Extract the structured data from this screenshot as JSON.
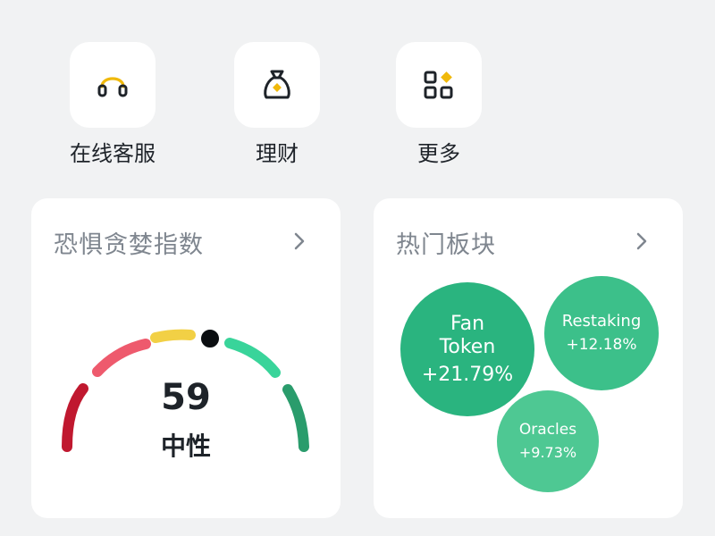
{
  "quick_actions": [
    {
      "label": "在线客服",
      "icon": "headset-icon"
    },
    {
      "label": "理财",
      "icon": "money-bag-icon"
    },
    {
      "label": "更多",
      "icon": "grid-more-icon"
    }
  ],
  "fear_greed": {
    "title": "恐惧贪婪指数",
    "score": "59",
    "sentiment": "中性",
    "level": 59,
    "colors": [
      "#c0182f",
      "#ee5a6d",
      "#f2d045",
      "#39d49a",
      "#2a9c6c"
    ]
  },
  "hot_sectors": {
    "title": "热门板块",
    "items": [
      {
        "name_line1": "Fan",
        "name_line2": "Token",
        "change": "+21.79%",
        "color": "#2ab47f"
      },
      {
        "name_line1": "Restaking",
        "name_line2": "",
        "change": "+12.18%",
        "color": "#3cc08a"
      },
      {
        "name_line1": "Oracles",
        "name_line2": "",
        "change": "+9.73%",
        "color": "#4ec893"
      }
    ]
  },
  "colors": {
    "accent": "#f0b90b",
    "background": "#f1f2f3",
    "card": "#ffffff"
  }
}
